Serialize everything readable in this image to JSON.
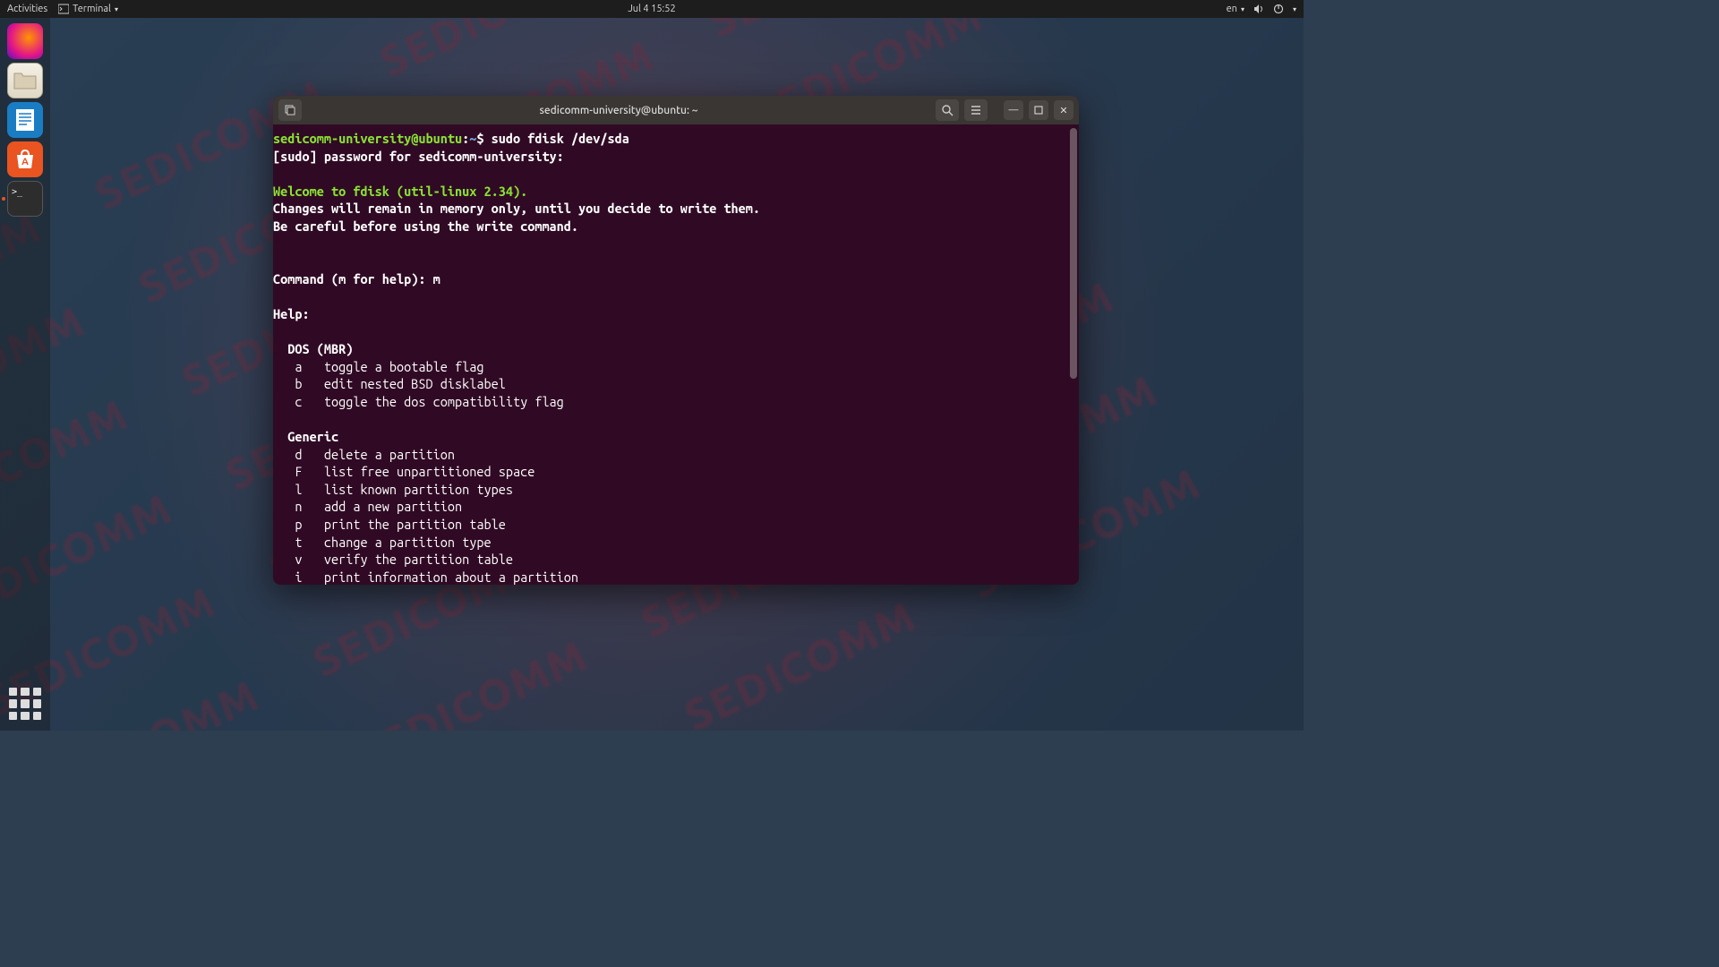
{
  "topbar": {
    "activities": "Activities",
    "app_menu": "Terminal",
    "clock": "Jul 4  15:52",
    "lang": "en"
  },
  "dock": {
    "items": [
      "firefox",
      "files",
      "writer",
      "software",
      "terminal"
    ]
  },
  "window": {
    "title": "sedicomm-university@ubuntu: ~"
  },
  "terminal": {
    "prompt_user": "sedicomm-university@ubuntu",
    "prompt_sep": ":",
    "prompt_path": "~",
    "prompt_dollar": "$ ",
    "command": "sudo fdisk /dev/sda",
    "sudo_line": "[sudo] password for sedicomm-university:",
    "welcome": "Welcome to fdisk (util-linux 2.34).",
    "warn1": "Changes will remain in memory only, until you decide to write them.",
    "warn2": "Be careful before using the write command.",
    "cmd_prompt": "Command (m for help): m",
    "help_head": "Help:",
    "sec_dos": "  DOS (MBR)",
    "dos_a": "   a   toggle a bootable flag",
    "dos_b": "   b   edit nested BSD disklabel",
    "dos_c": "   c   toggle the dos compatibility flag",
    "sec_gen": "  Generic",
    "gen_d": "   d   delete a partition",
    "gen_F": "   F   list free unpartitioned space",
    "gen_l": "   l   list known partition types",
    "gen_n": "   n   add a new partition",
    "gen_p": "   p   print the partition table",
    "gen_t": "   t   change a partition type",
    "gen_v": "   v   verify the partition table",
    "gen_i": "   i   print information about a partition"
  }
}
